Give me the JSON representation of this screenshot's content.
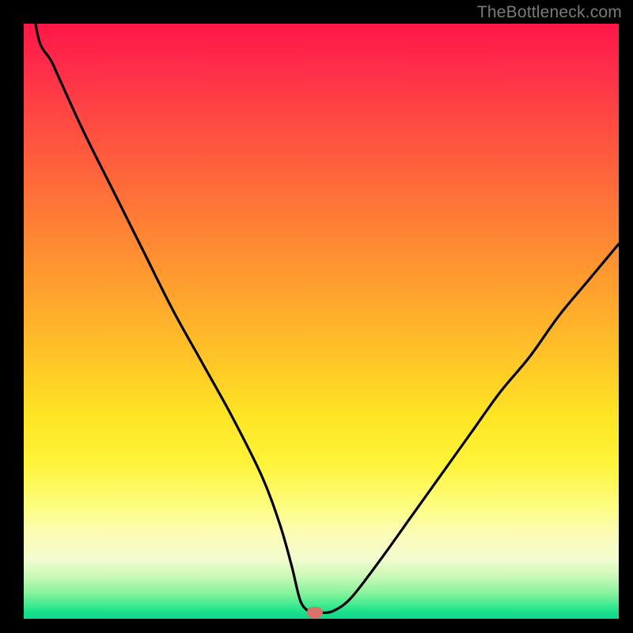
{
  "watermark": "TheBottleneck.com",
  "colors": {
    "frame": "#000000",
    "curve": "#000000",
    "dot": "#d8736a",
    "text": "#7a7a7a"
  },
  "chart_data": {
    "type": "line",
    "title": "",
    "xlabel": "",
    "ylabel": "",
    "xlim": [
      0,
      100
    ],
    "ylim": [
      0,
      100
    ],
    "grid": false,
    "legend": false,
    "series": [
      {
        "name": "bottleneck-curve",
        "x": [
          0,
          2,
          5,
          10,
          15,
          20,
          25,
          30,
          35,
          40,
          43,
          45,
          46.5,
          48,
          49,
          50,
          52,
          55,
          60,
          65,
          70,
          75,
          80,
          85,
          90,
          95,
          100
        ],
        "values": [
          126,
          100,
          93,
          82,
          72,
          62,
          52,
          43,
          34,
          24,
          16,
          9,
          3,
          1.2,
          1.0,
          1.0,
          1.3,
          3.5,
          10,
          17,
          24,
          31,
          38,
          44,
          51,
          57,
          63
        ]
      }
    ],
    "marker": {
      "x": 49,
      "y": 1.1
    }
  }
}
